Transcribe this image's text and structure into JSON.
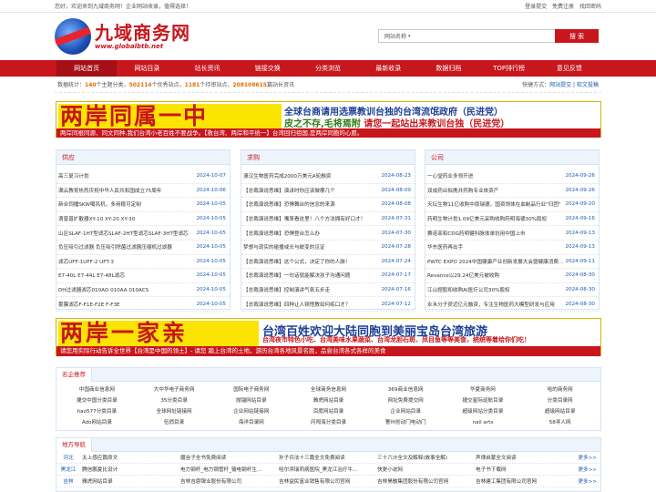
{
  "topbar": {
    "welcome": "您好，欢迎来到九域商务网！企业网站收录，值得选择！",
    "login": "登录提交",
    "register": "免费注册",
    "forgot": "找回密码"
  },
  "logo": {
    "cn": "九域商务网",
    "en": "www.globalbtb.net"
  },
  "search": {
    "select": "网站名称",
    "button": "搜 索"
  },
  "nav": [
    "网站首页",
    "网站目录",
    "站长资讯",
    "链接交换",
    "分类浏览",
    "最新收录",
    "数据归档",
    "TOP排行榜",
    "意见反馈"
  ],
  "stats": {
    "prefix": "数据统计：",
    "main_cat": "140",
    "main_cat_label": "个主题分类，",
    "sites": "502114",
    "sites_label": "个优秀站点，",
    "pending": "1181",
    "pending_label": "个待审站点，",
    "hits": "208108615",
    "hits_label": "篇站长资讯",
    "quick": "快捷方式：",
    "q1": "网站提交",
    "q2": "软文投稿"
  },
  "banner1": {
    "big": "两岸同属一中",
    "line1": "全球台商请用选票教训台独的台湾流氓政府（民进党）",
    "line2a": "皮之不存,毛将焉附",
    "line2b": "请您一起站出来教训台独（民进党）",
    "strip": "两岸同根同源、同文同种,我们台湾小老百姓不要战争。【救台湾、两岸和平统一】台湾回归祖国,是两岸同胞的心愿。"
  },
  "supply": {
    "title": "供应",
    "rows": [
      {
        "t": "高三复习计划",
        "d": "2024-10-07"
      },
      {
        "t": "满云教育热烈庆祝中华人民共和国成立75周年",
        "d": "2024-10-06"
      },
      {
        "t": "新合饲播SKW噶风机，多用稳可定制",
        "d": "2024-10-05"
      },
      {
        "t": "滴普普扩散器XY-10 XY-20 XY-30",
        "d": "2024-10-05"
      },
      {
        "t": "山区SLAF-1HT型滤芯SLAF-2HT型滤芯SLAF-3HT型滤芯",
        "d": "2024-10-05"
      },
      {
        "t": "负压吸引过滤器 负压吸引除菌过滤器压缩机过滤器",
        "d": "2024-10-05"
      },
      {
        "t": "滤芯UFF-1UFF-2 UFT-3",
        "d": "2024-10-05"
      },
      {
        "t": "E7-40L E7-44L E7-48L滤芯",
        "d": "2024-10-05"
      },
      {
        "t": "DH过滤器滤芯010AO 010AA 010ACS",
        "d": "2024-10-05"
      },
      {
        "t": "雾膜滤芯F-F1E-F2E F-F3E",
        "d": "2024-10-05"
      }
    ]
  },
  "demand": {
    "title": "求购",
    "rows": [
      {
        "t": "澳汉生物医药完成2000万美元A轮融资",
        "d": "2024-08-23"
      },
      {
        "t": "【总裁演说思维】演讲时你应该做哪几个",
        "d": "2024-08-09"
      },
      {
        "t": "【总裁演说思维】恐惧舞台的信念的来源",
        "d": "2024-08-08"
      },
      {
        "t": "【总裁演说思维】嘴笨看这里！八个方法拥有好口才！",
        "d": "2024-07-31"
      },
      {
        "t": "【总裁演说思维】恐惧登台怎么办",
        "d": "2024-07-30"
      },
      {
        "t": "梦想与现实的碰撞或长与蜕变的见证",
        "d": "2024-07-28"
      },
      {
        "t": "【总裁演说思维】这个公式，决定了你的人脉！",
        "d": "2024-07-24"
      },
      {
        "t": "【总裁演说思维】一句话就能解决孩子沟通问题",
        "d": "2024-07-17"
      },
      {
        "t": "【总裁演说思维】控制演讲气氛五步走",
        "d": "2024-07-16"
      },
      {
        "t": "【总裁演说思维】四种让人顿悟教如何练口才？",
        "d": "2024-07-12"
      }
    ]
  },
  "company": {
    "title": "公司",
    "rows": [
      {
        "t": "一心堂药业多领开进",
        "d": "2024-09-26"
      },
      {
        "t": "双成药业拟携并药购专业体资产",
        "d": "2024-09-26"
      },
      {
        "t": "天坛生物11亿收购中原瑞德，国资领体在血制品行业\"归团\"",
        "d": "2024-09-20"
      },
      {
        "t": "药明生物计划1.09亿美元采购收购药明海德30%股权",
        "d": "2024-09-16"
      },
      {
        "t": "赛诺菲和CDG药明健科脉体单抗用中国上市",
        "d": "2024-09-13"
      },
      {
        "t": "华东医药再出手",
        "d": "2024-09-13"
      },
      {
        "t": "PWTC EXPO 2024中国健康产业创新发展大会暨健康消费...",
        "d": "2024-09-11"
      },
      {
        "t": "Revance以29.24亿美元被收购",
        "d": "2024-08-30"
      },
      {
        "t": "江山捏股和收购AI医疗公司30%股权",
        "d": "2024-08-30"
      },
      {
        "t": "永禾分子获近亿元融资，专注生物医药大模型研发与应用",
        "d": "2024-08-30"
      }
    ]
  },
  "banner2": {
    "big": "两岸一家亲",
    "line1": "台湾百姓欢迎大陆同胞到美丽宝岛台湾旅游",
    "line2": "台湾夜市特色小吃、台湾美味水果蔬菜、台湾龙胆石斑、凤目鱼等等美食，统统等着给你们吃！",
    "strip": "请您用实际行动告诉全世界【台湾是中国的领土】- 请您 踏上台湾的土地，游历台湾各地风景名胜，品尝台湾各式各样的美食"
  },
  "links": {
    "title": "名企推荐",
    "items": [
      "中国商业信息网",
      "大中华电子商务网",
      "国际电子商务网",
      "全球商务信息网",
      "369商业信息网",
      "华夏商务网",
      "哈的商务网",
      "捷交中国分类目录",
      "35分类目录",
      "抛锚网站目录",
      "雅虎网站目录",
      "网址免费提交网",
      "捷交星际巡航目录",
      "分类目录网",
      "hao577分类目录",
      "全球网址链接网",
      "企业网站链接网",
      "百度网站目录",
      "企业网站目录",
      "超级网站分类目录",
      "超级网站目录",
      "Ado网站目录",
      "伍俏目录",
      "海洋目录网",
      "闪闯海分类目录",
      "奢州创动门电动门",
      "nail arts",
      "58寻人网"
    ]
  },
  "regions": {
    "title": "地方导航",
    "more": "更多>>",
    "rows": [
      {
        "p": "河北",
        "s": [
          "太上感应篇原文",
          "魔谷子全书免费阅读",
          "孙子兵法十三篇全文免费阅读",
          "三十六计全文及解释(故事全解)",
          "声律启蒙全文阅读"
        ]
      },
      {
        "p": "黑龙江",
        "s": [
          "腾信鹏夏比设计",
          "电力钢杆_电力钢管杆_输电钢杆生...",
          "哈尔滨瑞莉病医院_黑龙江治疗牛...",
          "快更小说网",
          "电子书下载网"
        ]
      },
      {
        "p": "吉林",
        "s": [
          "雅虎网站目录",
          "吉林吉恩镍业股份有限公司",
          "吉林益民富业销售有限公司官网",
          "吉林昊融集团股份有限公司官网",
          "吉林建工集团有限公司官网"
        ]
      }
    ]
  }
}
